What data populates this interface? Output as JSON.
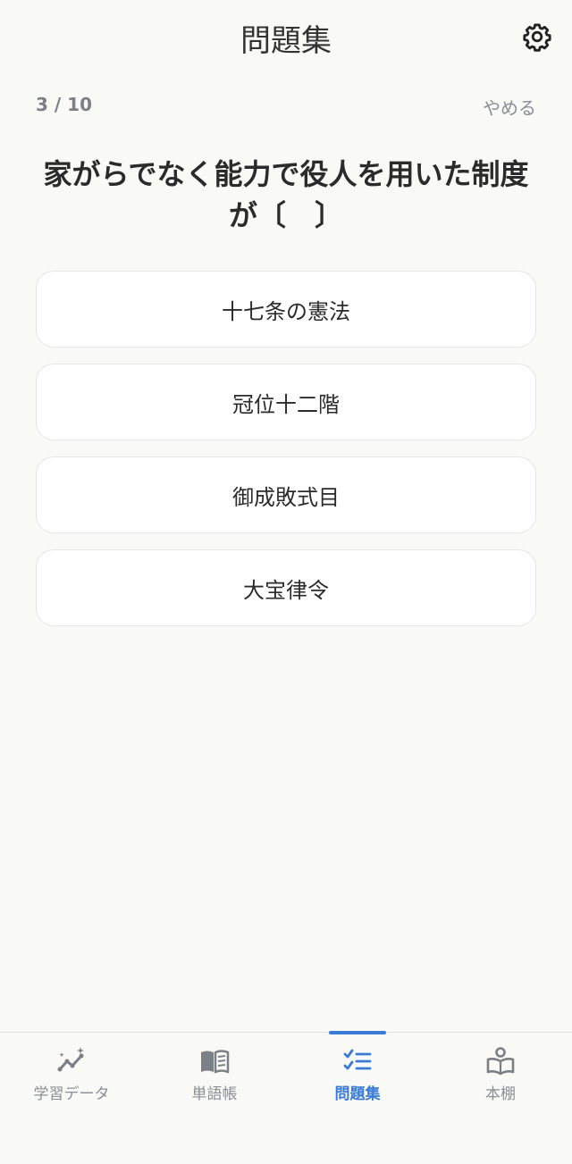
{
  "header": {
    "title": "問題集"
  },
  "quiz": {
    "progress": "3 / 10",
    "quit_label": "やめる",
    "question": "家がらでなく能力で役人を用いた制度が〔　〕",
    "choices": [
      "十七条の憲法",
      "冠位十二階",
      "御成敗式目",
      "大宝律令"
    ]
  },
  "tabs": [
    {
      "label": "学習データ",
      "icon": "sparkle-chart-icon"
    },
    {
      "label": "単語帳",
      "icon": "open-book-icon"
    },
    {
      "label": "問題集",
      "icon": "checklist-icon",
      "active": true
    },
    {
      "label": "本棚",
      "icon": "reader-book-icon"
    }
  ],
  "colors": {
    "accent": "#3a7bd5",
    "background": "#f9f9f6",
    "muted": "#8a8e94"
  }
}
